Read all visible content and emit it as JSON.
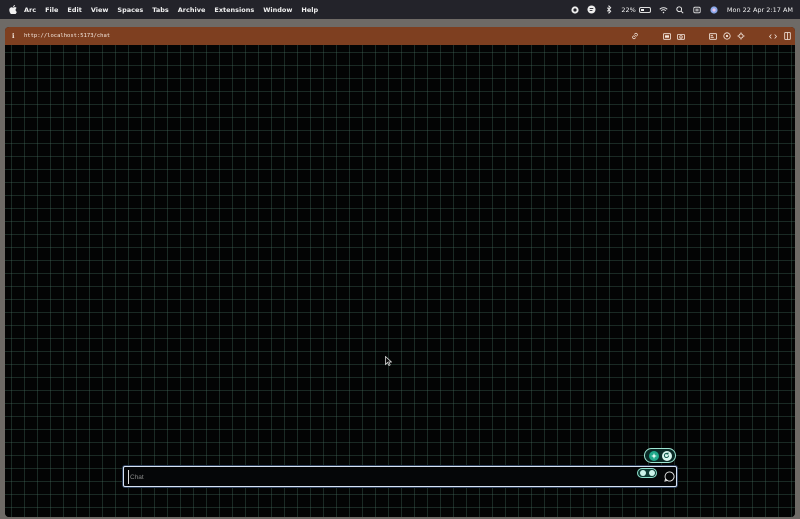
{
  "menubar": {
    "apple_icon": "apple-logo-icon",
    "items": [
      "Arc",
      "File",
      "Edit",
      "View",
      "Spaces",
      "Tabs",
      "Archive",
      "Extensions",
      "Window",
      "Help"
    ],
    "status": {
      "battery_percent": "22%",
      "datetime": "Mon 22 Apr  2:17 AM"
    }
  },
  "browser": {
    "url": "http://localhost:5173/chat",
    "toolbar_color": "#7e3f20"
  },
  "chat": {
    "input_placeholder": "Chat",
    "input_value": ""
  },
  "colors": {
    "canvas_bg": "#030404",
    "grid_line": "#466e5f",
    "accent": "#1fa88a",
    "input_border": "#d7e2f3"
  }
}
